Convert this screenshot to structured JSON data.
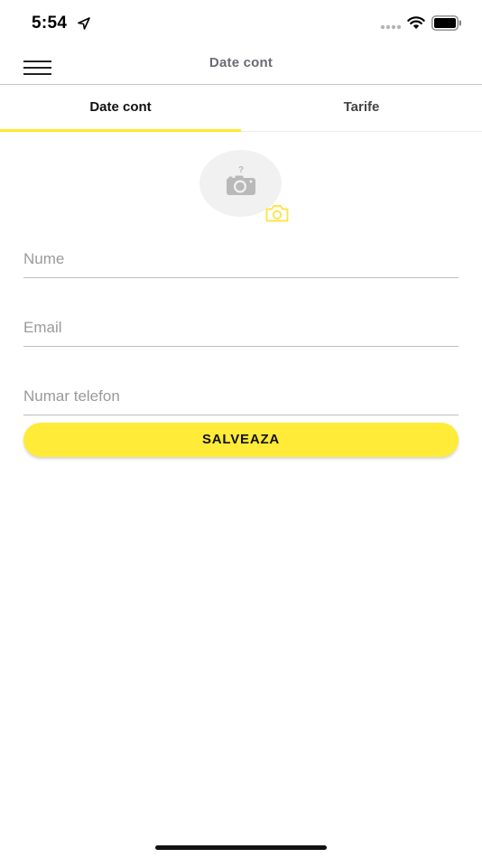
{
  "status_bar": {
    "time": "5:54"
  },
  "nav": {
    "title": "Date cont"
  },
  "tabs": [
    {
      "label": "Date cont",
      "selected": true
    },
    {
      "label": "Tarife",
      "selected": false
    }
  ],
  "avatar": {
    "placeholder_icon": "camera-question-icon",
    "edit_icon": "camera-icon"
  },
  "form": {
    "name_placeholder": "Nume",
    "email_placeholder": "Email",
    "phone_placeholder": "Numar telefon",
    "name_value": "",
    "email_value": "",
    "phone_value": ""
  },
  "save_button": {
    "label": "SALVEAZA"
  },
  "colors": {
    "accent": "#ffeb38",
    "tab_indicator": "#ffe92f",
    "camera_outline": "#ffe33a"
  }
}
